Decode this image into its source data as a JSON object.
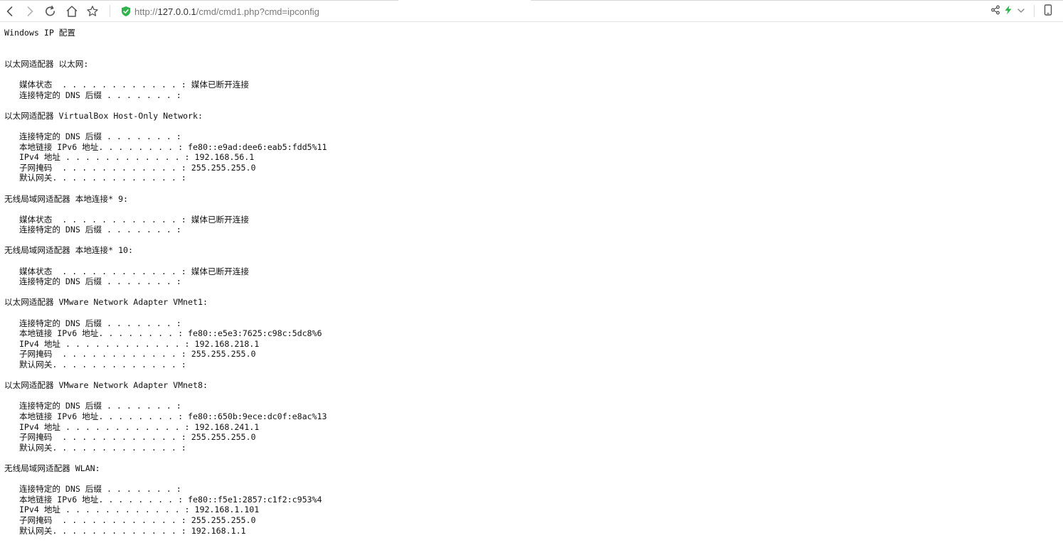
{
  "browser": {
    "url_scheme": "http://",
    "url_host": "127.0.0.1",
    "url_path": "/cmd/cmd1.php?cmd=ipconfig",
    "icons": {
      "back": "chevron-left-icon",
      "forward": "chevron-right-icon",
      "reload": "reload-icon",
      "home": "home-icon",
      "bookmark": "star-icon",
      "security": "shield-check-icon",
      "share": "share-icon",
      "speed": "lightning-icon",
      "menu": "chevron-down-icon",
      "device": "mobile-icon"
    },
    "colors": {
      "shield": "#2fb34a",
      "lightning": "#2fb34a",
      "icon": "#555555"
    }
  },
  "output": {
    "lines": [
      "Windows IP 配置",
      "",
      "",
      "以太网适配器 以太网:",
      "",
      "   媒体状态  . . . . . . . . . . . . : 媒体已断开连接",
      "   连接特定的 DNS 后缀 . . . . . . . :",
      "",
      "以太网适配器 VirtualBox Host-Only Network:",
      "",
      "   连接特定的 DNS 后缀 . . . . . . . :",
      "   本地链接 IPv6 地址. . . . . . . . : fe80::e9ad:dee6:eab5:fdd5%11",
      "   IPv4 地址 . . . . . . . . . . . . : 192.168.56.1",
      "   子网掩码  . . . . . . . . . . . . : 255.255.255.0",
      "   默认网关. . . . . . . . . . . . . :",
      "",
      "无线局域网适配器 本地连接* 9:",
      "",
      "   媒体状态  . . . . . . . . . . . . : 媒体已断开连接",
      "   连接特定的 DNS 后缀 . . . . . . . :",
      "",
      "无线局域网适配器 本地连接* 10:",
      "",
      "   媒体状态  . . . . . . . . . . . . : 媒体已断开连接",
      "   连接特定的 DNS 后缀 . . . . . . . :",
      "",
      "以太网适配器 VMware Network Adapter VMnet1:",
      "",
      "   连接特定的 DNS 后缀 . . . . . . . :",
      "   本地链接 IPv6 地址. . . . . . . . : fe80::e5e3:7625:c98c:5dc8%6",
      "   IPv4 地址 . . . . . . . . . . . . : 192.168.218.1",
      "   子网掩码  . . . . . . . . . . . . : 255.255.255.0",
      "   默认网关. . . . . . . . . . . . . :",
      "",
      "以太网适配器 VMware Network Adapter VMnet8:",
      "",
      "   连接特定的 DNS 后缀 . . . . . . . :",
      "   本地链接 IPv6 地址. . . . . . . . : fe80::650b:9ece:dc0f:e8ac%13",
      "   IPv4 地址 . . . . . . . . . . . . : 192.168.241.1",
      "   子网掩码  . . . . . . . . . . . . : 255.255.255.0",
      "   默认网关. . . . . . . . . . . . . :",
      "",
      "无线局域网适配器 WLAN:",
      "",
      "   连接特定的 DNS 后缀 . . . . . . . :",
      "   本地链接 IPv6 地址. . . . . . . . : fe80::f5e1:2857:c1f2:c953%4",
      "   IPv4 地址 . . . . . . . . . . . . : 192.168.1.101",
      "   子网掩码  . . . . . . . . . . . . : 255.255.255.0",
      "   默认网关. . . . . . . . . . . . . : 192.168.1.1"
    ]
  }
}
